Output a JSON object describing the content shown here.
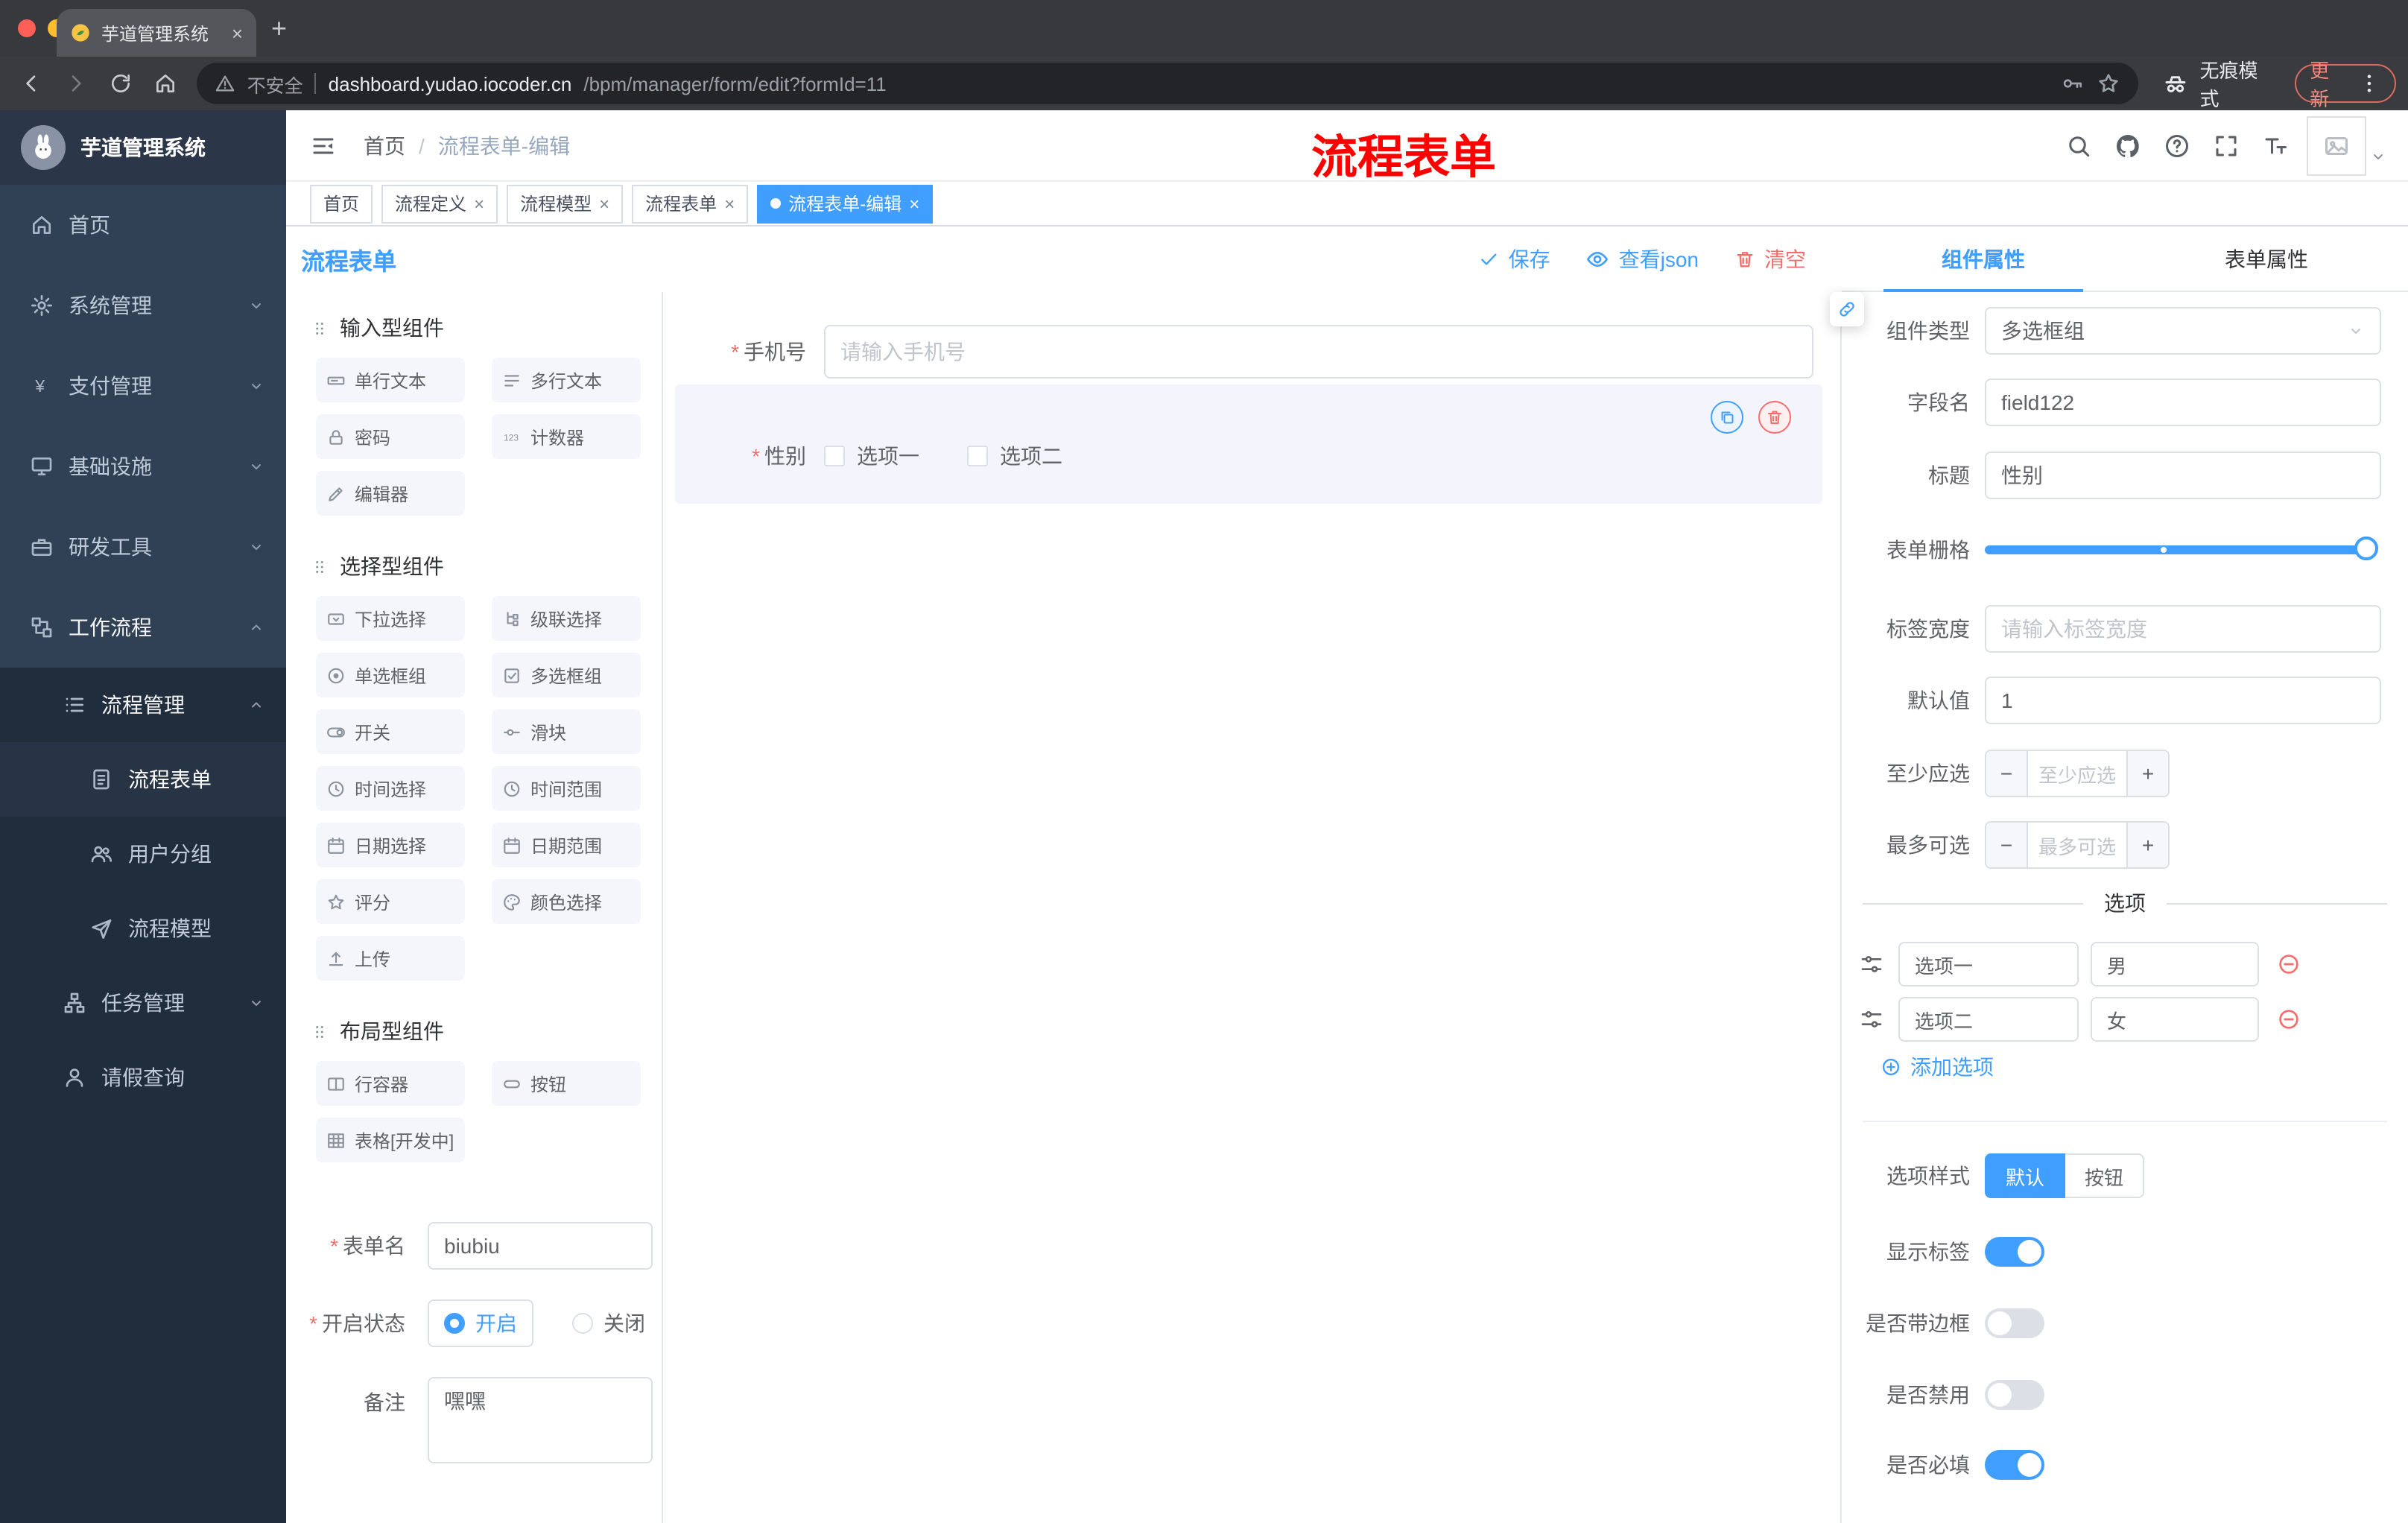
{
  "ui": {
    "close": "×",
    "plus_tab": "+",
    "minus": "−",
    "plus": "+",
    "breadcrumb_sep": "/",
    "url_divider": "|"
  },
  "colors": {
    "primary": "#409EFF",
    "danger": "#F56C6C",
    "annotation_red": "#FF0000",
    "sidebar_bg": "#304156",
    "submenu_bg": "#1F2D3D",
    "active_tag_bg": "#409EFF",
    "browser_update": "#F28B82"
  },
  "browser": {
    "tab_title": "芋道管理系统",
    "security_label": "不安全",
    "url_host": "dashboard.yudao.iocoder.cn",
    "url_path": "/bpm/manager/form/edit?formId=11",
    "incognito_label": "无痕模式",
    "update_label": "更新"
  },
  "sidebar": {
    "logo_title": "芋道管理系统",
    "menu": [
      {
        "label": "首页"
      },
      {
        "label": "系统管理"
      },
      {
        "label": "支付管理"
      },
      {
        "label": "基础设施"
      },
      {
        "label": "研发工具"
      },
      {
        "label": "工作流程"
      },
      {
        "label": "流程管理"
      },
      {
        "label": "流程表单"
      },
      {
        "label": "用户分组"
      },
      {
        "label": "流程模型"
      },
      {
        "label": "任务管理"
      },
      {
        "label": "请假查询"
      }
    ]
  },
  "header": {
    "breadcrumb_home": "首页",
    "breadcrumb_current": "流程表单-编辑",
    "annotation": "流程表单"
  },
  "tags": [
    {
      "label": "首页"
    },
    {
      "label": "流程定义"
    },
    {
      "label": "流程模型"
    },
    {
      "label": "流程表单"
    },
    {
      "label": "流程表单-编辑"
    }
  ],
  "designer": {
    "title": "流程表单",
    "save_label": "保存",
    "view_json_label": "查看json",
    "clear_label": "清空",
    "palette": {
      "groups": [
        {
          "title": "输入型组件",
          "items": [
            "单行文本",
            "多行文本",
            "密码",
            "计数器",
            "编辑器"
          ]
        },
        {
          "title": "选择型组件",
          "items": [
            "下拉选择",
            "级联选择",
            "单选框组",
            "多选框组",
            "开关",
            "滑块",
            "时间选择",
            "时间范围",
            "日期选择",
            "日期范围",
            "评分",
            "颜色选择",
            "上传"
          ]
        },
        {
          "title": "布局型组件",
          "items": [
            "行容器",
            "按钮",
            "表格[开发中]"
          ]
        }
      ]
    },
    "form_meta": {
      "name_label": "表单名",
      "name_value": "biubiu",
      "status_label": "开启状态",
      "status_on": "开启",
      "status_off": "关闭",
      "remark_label": "备注",
      "remark_value": "嘿嘿"
    },
    "canvas": {
      "phone_label": "手机号",
      "phone_placeholder": "请输入手机号",
      "gender_label": "性别",
      "gender_option1": "选项一",
      "gender_option2": "选项二"
    }
  },
  "props": {
    "tab_component": "组件属性",
    "tab_form": "表单属性",
    "component_type_label": "组件类型",
    "component_type_value": "多选框组",
    "field_name_label": "字段名",
    "field_name_value": "field122",
    "title_label": "标题",
    "title_value": "性别",
    "grid_label": "表单栅格",
    "label_width_label": "标签宽度",
    "label_width_placeholder": "请输入标签宽度",
    "default_label": "默认值",
    "default_value": "1",
    "min_label": "至少应选",
    "min_placeholder": "至少应选",
    "max_label": "最多可选",
    "max_placeholder": "最多可选",
    "options_title": "选项",
    "option_rows": [
      {
        "label": "选项一",
        "value": "男"
      },
      {
        "label": "选项二",
        "value": "女"
      }
    ],
    "add_option_label": "添加选项",
    "style_label": "选项样式",
    "style_default": "默认",
    "style_button": "按钮",
    "switch_show_label": "显示标签",
    "switch_border": "是否带边框",
    "switch_disabled": "是否禁用",
    "switch_required": "是否必填"
  }
}
